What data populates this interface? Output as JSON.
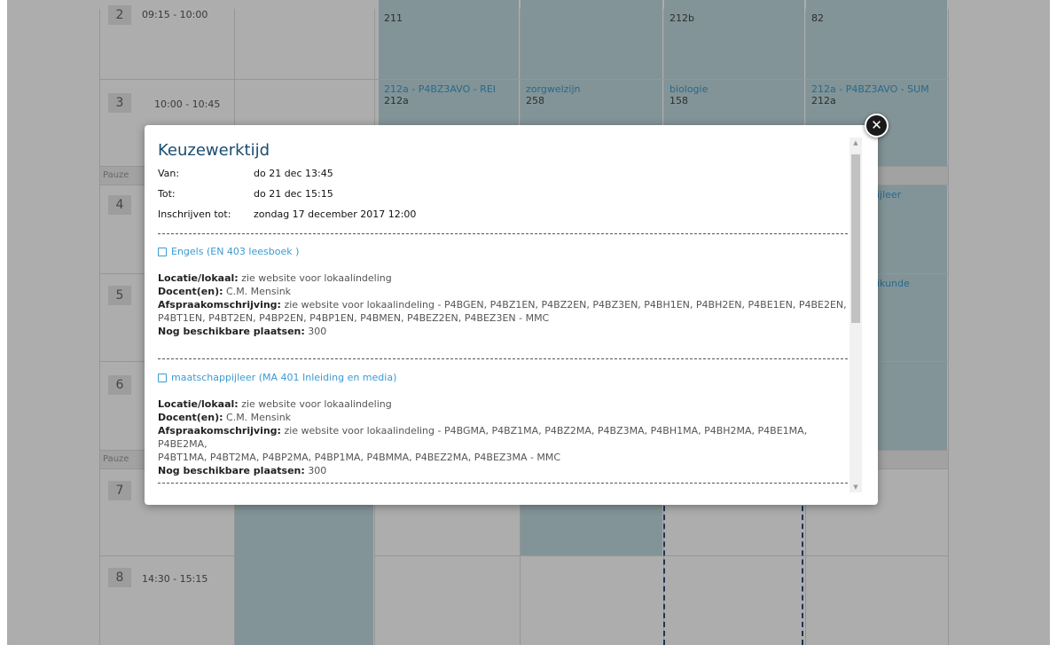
{
  "schedule": {
    "periods": [
      {
        "num": "2",
        "time": "09:15 - 10:00"
      },
      {
        "num": "3",
        "time": "10:00 - 10:45"
      },
      {
        "num": "4",
        "time": ""
      },
      {
        "num": "5",
        "time": ""
      },
      {
        "num": "6",
        "time": ""
      },
      {
        "num": "7",
        "time": ""
      },
      {
        "num": "8",
        "time": "14:30 - 15:15"
      }
    ],
    "pause_label": "Pauze",
    "row2": {
      "c2": "211",
      "c4": "212b",
      "c5": "82"
    },
    "row3": [
      {
        "subject": "212a - P4BZ3AVO - REI",
        "room": "212a"
      },
      {
        "subject": "zorgwelzijn",
        "room": "258"
      },
      {
        "subject": "biologie",
        "room": "158"
      },
      {
        "subject": "212a - P4BZ3AVO - SUM",
        "room": "212a"
      }
    ],
    "row4_partial": "ijleer",
    "row5_partial": "ikunde"
  },
  "modal": {
    "close_symbol": "✕",
    "title": "Keuzewerktijd",
    "van_label": "Van:",
    "van_value": "do 21 dec 13:45",
    "tot_label": "Tot:",
    "tot_value": "do 21 dec 15:15",
    "inschrijven_label": "Inschrijven tot:",
    "inschrijven_value": "zondag 17 december 2017 12:00",
    "options": [
      {
        "title": "Engels (EN 403 leesboek )",
        "locatie_label": "Locatie/lokaal:",
        "locatie": "zie website voor lokaalindeling",
        "docent_label": "Docent(en):",
        "docent": "C.M. Mensink",
        "omschrijving_label": "Afspraakomschrijving:",
        "omschrijving_line1": "zie website voor lokaalindeling - P4BGEN, P4BZ1EN, P4BZ2EN, P4BZ3EN, P4BH1EN, P4BH2EN, P4BE1EN, P4BE2EN,",
        "omschrijving_line2": "P4BT1EN, P4BT2EN, P4BP2EN, P4BP1EN, P4BMEN, P4BEZ2EN, P4BEZ3EN - MMC",
        "plaatsen_label": "Nog beschikbare plaatsen:",
        "plaatsen": "300"
      },
      {
        "title": "maatschappijleer (MA 401 Inleiding en media)",
        "locatie_label": "Locatie/lokaal:",
        "locatie": "zie website voor lokaalindeling",
        "docent_label": "Docent(en):",
        "docent": "C.M. Mensink",
        "omschrijving_label": "Afspraakomschrijving:",
        "omschrijving_line1": "zie website voor lokaalindeling - P4BGMA, P4BZ1MA, P4BZ2MA, P4BZ3MA, P4BH1MA, P4BH2MA, P4BE1MA, P4BE2MA,",
        "omschrijving_line2": "P4BT1MA, P4BT2MA, P4BP2MA, P4BP1MA, P4BMMA, P4BEZ2MA, P4BEZ3MA - MMC",
        "plaatsen_label": "Nog beschikbare plaatsen:",
        "plaatsen": "300"
      }
    ]
  },
  "scrollbar": {
    "up": "▲",
    "down": "▼"
  },
  "colors": {
    "overlay": "#000000",
    "cell": "#c0dadf",
    "link": "#3b9bd1",
    "title": "#1a4c6e"
  }
}
